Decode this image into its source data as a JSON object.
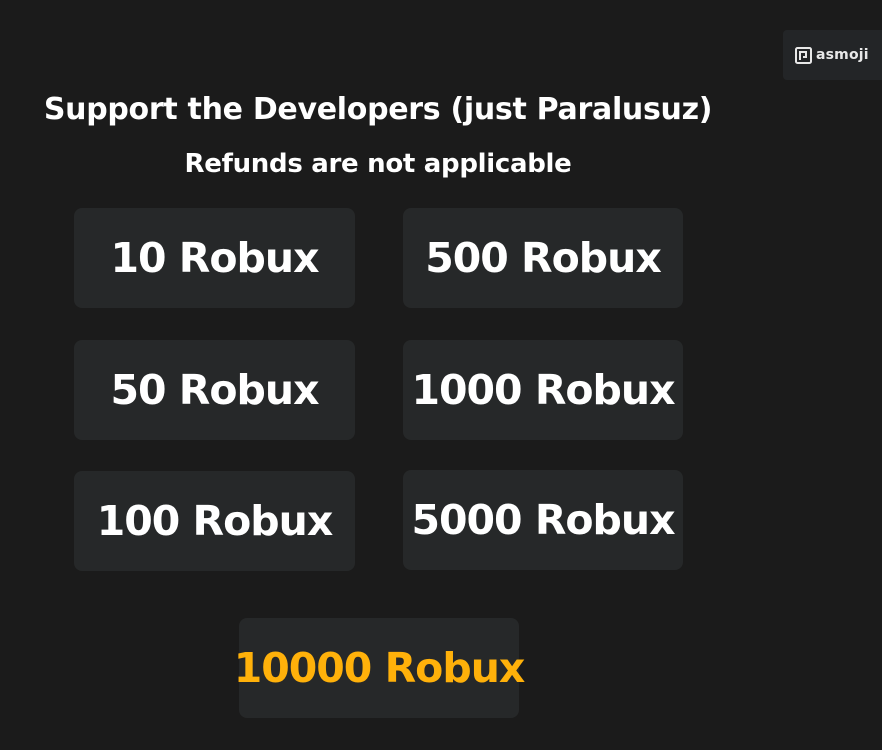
{
  "watermark": {
    "text": "asmoji",
    "icon": "asmoji-logo-icon"
  },
  "header": {
    "title": "Support the Developers (just Paralusuz)",
    "subtitle": "Refunds are not applicable"
  },
  "donations": {
    "items": [
      {
        "label": "10 Robux"
      },
      {
        "label": "500 Robux"
      },
      {
        "label": "50 Robux"
      },
      {
        "label": "1000 Robux"
      },
      {
        "label": "100 Robux"
      },
      {
        "label": "5000 Robux"
      },
      {
        "label": "10000 Robux"
      }
    ]
  },
  "colors": {
    "background": "#1b1b1b",
    "tile": "#262829",
    "text": "#ffffff",
    "highlight": "#ffb10a"
  }
}
